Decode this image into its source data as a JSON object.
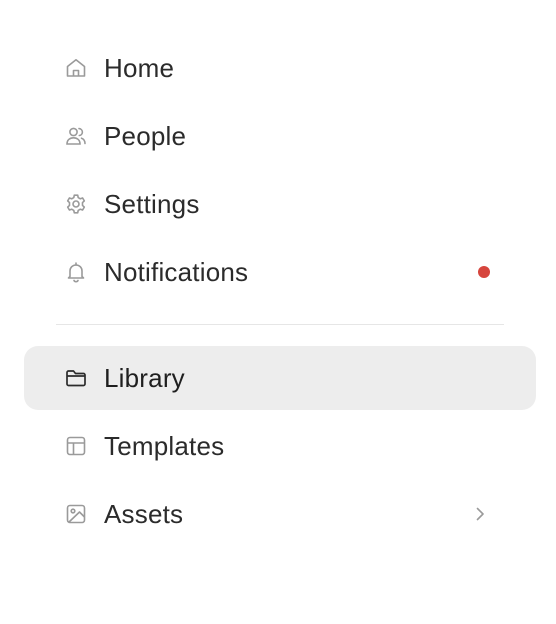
{
  "nav": {
    "items": [
      {
        "label": "Home",
        "icon": "home-icon"
      },
      {
        "label": "People",
        "icon": "people-icon"
      },
      {
        "label": "Settings",
        "icon": "gear-icon"
      },
      {
        "label": "Notifications",
        "icon": "bell-icon",
        "badge": "unread-dot"
      }
    ],
    "library_items": [
      {
        "label": "Library",
        "icon": "folder-icon",
        "active": true
      },
      {
        "label": "Templates",
        "icon": "template-icon"
      },
      {
        "label": "Assets",
        "icon": "image-icon",
        "has_submenu": true
      }
    ]
  },
  "colors": {
    "active_background": "#ededed",
    "notification_dot": "#d6453d",
    "divider": "#e6e6e6",
    "icon_muted": "#9a9a9a",
    "icon_active": "#2b2b2b"
  }
}
